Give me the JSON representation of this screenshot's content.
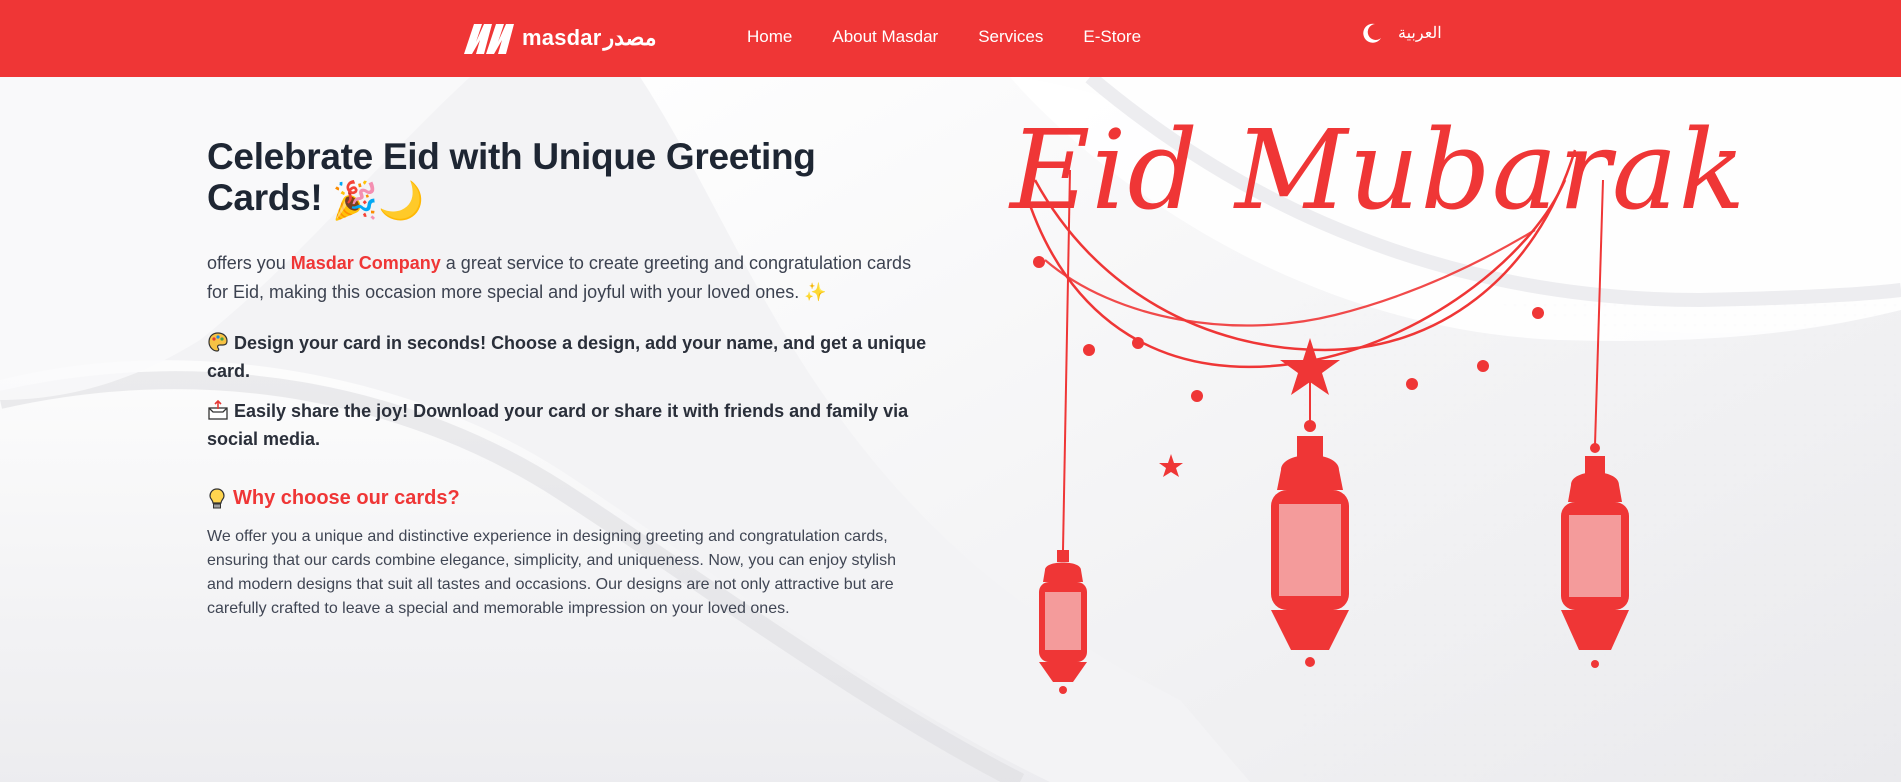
{
  "nav": {
    "logo_text": "masdar",
    "logo_arabic": "مصدر",
    "links": [
      {
        "label": "Home"
      },
      {
        "label": "About Masdar"
      },
      {
        "label": "Services"
      },
      {
        "label": "E-Store"
      }
    ],
    "language_label": "العربية",
    "theme_icon": "moon-icon"
  },
  "hero": {
    "title": "Celebrate Eid with Unique Greeting Cards!",
    "title_emojis": "🎉🌙",
    "intro_prefix": "offers you",
    "brand": "Masdar Company",
    "intro_suffix": "a great service to create greeting and congratulation cards for Eid, making this occasion more special and joyful with your loved ones.",
    "intro_emoji": "✨",
    "features": [
      {
        "icon": "palette-icon",
        "text": "Design your card in seconds! Choose a design, add your name, and get a unique card."
      },
      {
        "icon": "outbox-icon",
        "text": "Easily share the joy! Download your card or share it with friends and family via social media."
      }
    ],
    "why_title": "Why choose our cards?",
    "why_icon": "lightbulb-icon",
    "why_text": "We offer you a unique and distinctive experience in designing greeting and congratulation cards, ensuring that our cards combine elegance, simplicity, and uniqueness. Now, you can enjoy stylish and modern designs that suit all tastes and occasions. Our designs are not only attractive but are carefully crafted to leave a special and memorable impression on your loved ones."
  },
  "art": {
    "eid_text": "Eid Mubarak"
  },
  "colors": {
    "brand_red": "#ef3636",
    "heading": "#1e2633",
    "body_text": "#3c4250"
  }
}
